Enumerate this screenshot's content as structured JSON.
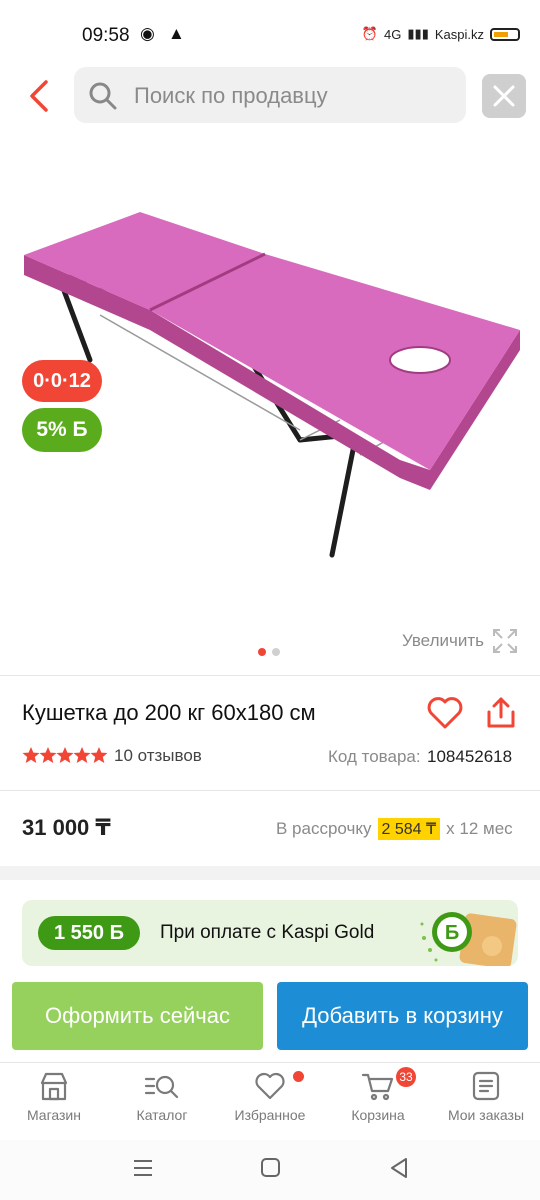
{
  "status_bar": {
    "time": "09:58",
    "carrier": "Kaspi.kz",
    "network": "4G"
  },
  "search": {
    "placeholder": "Поиск по продавцу"
  },
  "product": {
    "badges": {
      "installment": "0·0·12",
      "bonus": "5% Б"
    },
    "zoom_label": "Увеличить",
    "gallery": {
      "current": 1,
      "total": 2
    },
    "title": "Кушетка до 200 кг 60x180 см",
    "rating": 5,
    "reviews": "10 отзывов",
    "code_label": "Код товара:",
    "code_value": "108452618",
    "price": "31 000 ₸",
    "installment_label": "В рассрочку",
    "installment_amount": "2 584 ₸",
    "installment_term": "x 12 мес"
  },
  "gold_banner": {
    "bonus": "1 550 Б",
    "text": "При оплате с Kaspi Gold"
  },
  "actions": {
    "buy_now": "Оформить сейчас",
    "add_to_cart": "Добавить в корзину"
  },
  "nav": {
    "items": [
      {
        "label": "Магазин",
        "icon": "store-icon"
      },
      {
        "label": "Каталог",
        "icon": "catalog-icon"
      },
      {
        "label": "Избранное",
        "icon": "heart-icon"
      },
      {
        "label": "Корзина",
        "icon": "cart-icon"
      },
      {
        "label": "Мои заказы",
        "icon": "orders-icon"
      }
    ],
    "cart_count": "33"
  },
  "colors": {
    "accent_red": "#f14635",
    "green": "#5aac1c",
    "blue": "#1d8ed6",
    "light_green": "#96d15e"
  }
}
